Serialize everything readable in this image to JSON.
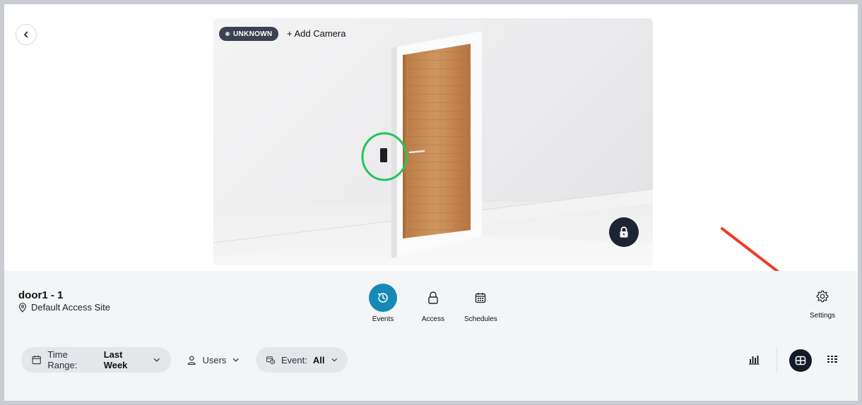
{
  "camera": {
    "status": "UNKNOWN",
    "add_camera_label": "+ Add Camera"
  },
  "icons": {
    "back": "chevron-left-icon",
    "lock": "lock-icon",
    "location": "location-pin-icon",
    "events": "history-clock-icon",
    "access": "lock-outline-icon",
    "schedules": "calendar-icon",
    "settings": "gear-icon",
    "time_range": "calendar-icon",
    "users": "user-icon",
    "event": "calendar-clock-icon",
    "chart": "bar-chart-icon",
    "card_view": "grid-card-icon",
    "list_view": "list-grid-icon"
  },
  "door": {
    "name": "door1 - 1",
    "site": "Default Access Site"
  },
  "nav": {
    "events": "Events",
    "access": "Access",
    "schedules": "Schedules",
    "active": "Events"
  },
  "settings_label": "Settings",
  "filters": {
    "time_range_label": "Time Range:",
    "time_range_value": "Last Week",
    "users_label": "Users",
    "event_label": "Event:",
    "event_value": "All"
  },
  "colors": {
    "accent": "#1689b6",
    "dark": "#1d2433",
    "highlight_circle": "#22c55e",
    "annotation_arrow": "#ef3b24"
  }
}
